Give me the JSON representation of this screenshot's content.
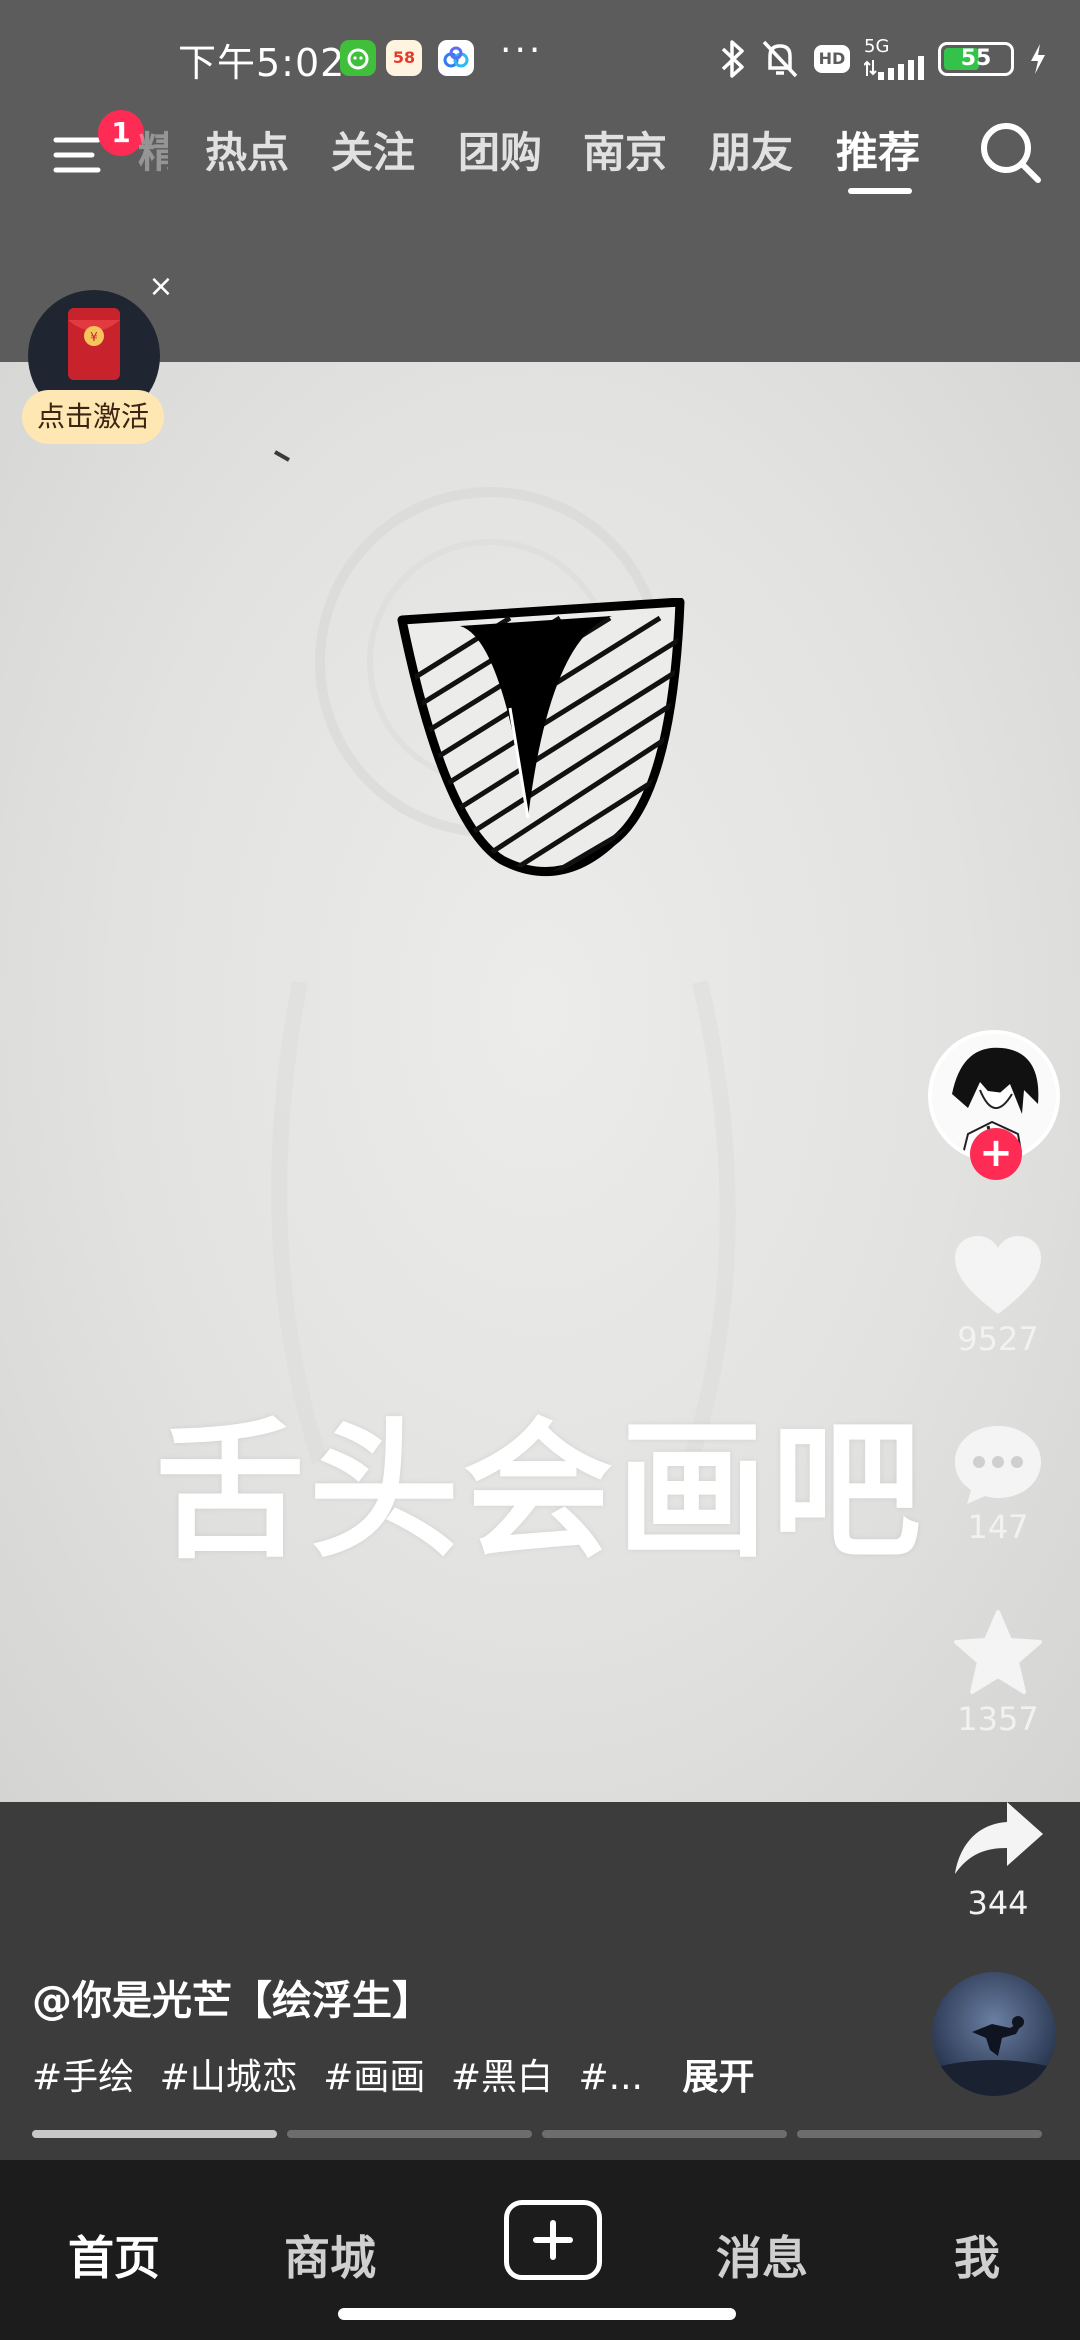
{
  "status_bar": {
    "time": "下午5:02",
    "app_icons": [
      {
        "name": "app-icon-green",
        "label": "",
        "color": "#3fbf3a"
      },
      {
        "name": "app-icon-58",
        "label": "58",
        "color": "#fff4e0"
      },
      {
        "name": "app-icon-cloud",
        "label": "",
        "color": "#ffffff"
      }
    ],
    "dots": "···",
    "network": "5G",
    "hd": "HD",
    "battery": "55",
    "battery_level_percent": 55
  },
  "tabs": {
    "notification_count": "1",
    "faded_tab": "精选",
    "items": [
      {
        "label": "热点",
        "active": false
      },
      {
        "label": "关注",
        "active": false
      },
      {
        "label": "团购",
        "active": false
      },
      {
        "label": "南京",
        "active": false
      },
      {
        "label": "朋友",
        "active": false
      },
      {
        "label": "推荐",
        "active": true
      }
    ]
  },
  "red_packet": {
    "activate_label": "点击激活",
    "close_label": "×",
    "coin_label": "¥"
  },
  "video": {
    "caption": "舌头会画吧"
  },
  "actions": {
    "like_count": "9527",
    "comment_count": "147",
    "favorite_count": "1357",
    "share_count": "344",
    "follow_label": "+"
  },
  "post": {
    "author": "@你是光芒【绘浮生】",
    "tags": [
      "#手绘",
      "#山城恋",
      "#画画",
      "#黑白",
      "#..."
    ],
    "expand_label": "展开"
  },
  "progress": {
    "segments": 4,
    "current_segment_fill": 1.0
  },
  "bottom_nav": {
    "home": "首页",
    "mall": "商城",
    "messages": "消息",
    "me": "我"
  },
  "colors": {
    "accent": "#fe2c55",
    "top_bg": "#5c5c5c",
    "nav_bg": "#1c1c1c",
    "pill_bg": "#ffe7b4"
  }
}
